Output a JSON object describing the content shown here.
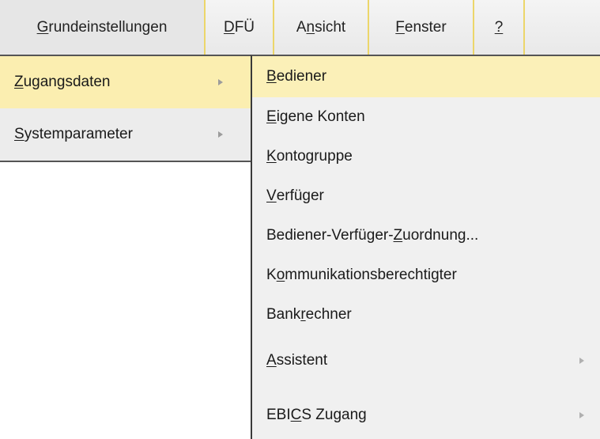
{
  "menubar": {
    "items": [
      {
        "pre": "",
        "u": "G",
        "post": "rundeinstellungen"
      },
      {
        "pre": "",
        "u": "D",
        "post": "FÜ"
      },
      {
        "pre": "A",
        "u": "n",
        "post": "sicht"
      },
      {
        "pre": "",
        "u": "F",
        "post": "enster"
      },
      {
        "pre": "",
        "u": "?",
        "post": ""
      }
    ]
  },
  "menu1": {
    "items": [
      {
        "pre": "",
        "u": "Z",
        "post": "ugangsdaten",
        "highlighted": true,
        "submenu": true
      },
      {
        "pre": "",
        "u": "S",
        "post": "ystemparameter",
        "highlighted": false,
        "submenu": true
      }
    ]
  },
  "menu2": {
    "items": [
      {
        "pre": "",
        "u": "B",
        "post": "ediener",
        "highlighted": true,
        "submenu": false
      },
      {
        "pre": "",
        "u": "E",
        "post": "igene Konten",
        "highlighted": false,
        "submenu": false
      },
      {
        "pre": "",
        "u": "K",
        "post": "ontogruppe",
        "highlighted": false,
        "submenu": false
      },
      {
        "pre": "",
        "u": "V",
        "post": "erfüger",
        "highlighted": false,
        "submenu": false
      },
      {
        "pre": "Bediener-Verfüger-",
        "u": "Z",
        "post": "uordnung...",
        "highlighted": false,
        "submenu": false
      },
      {
        "pre": "K",
        "u": "o",
        "post": "mmunikationsberechtigter",
        "highlighted": false,
        "submenu": false
      },
      {
        "pre": "Bank",
        "u": "r",
        "post": "echner",
        "highlighted": false,
        "submenu": false
      },
      {
        "pre": "",
        "u": "A",
        "post": "ssistent",
        "highlighted": false,
        "submenu": true
      },
      {
        "pre": "EBI",
        "u": "C",
        "post": "S Zugang",
        "highlighted": false,
        "submenu": true
      }
    ]
  },
  "colors": {
    "highlight": "#fbeeb0",
    "menubar_separator": "#ecd66a"
  }
}
